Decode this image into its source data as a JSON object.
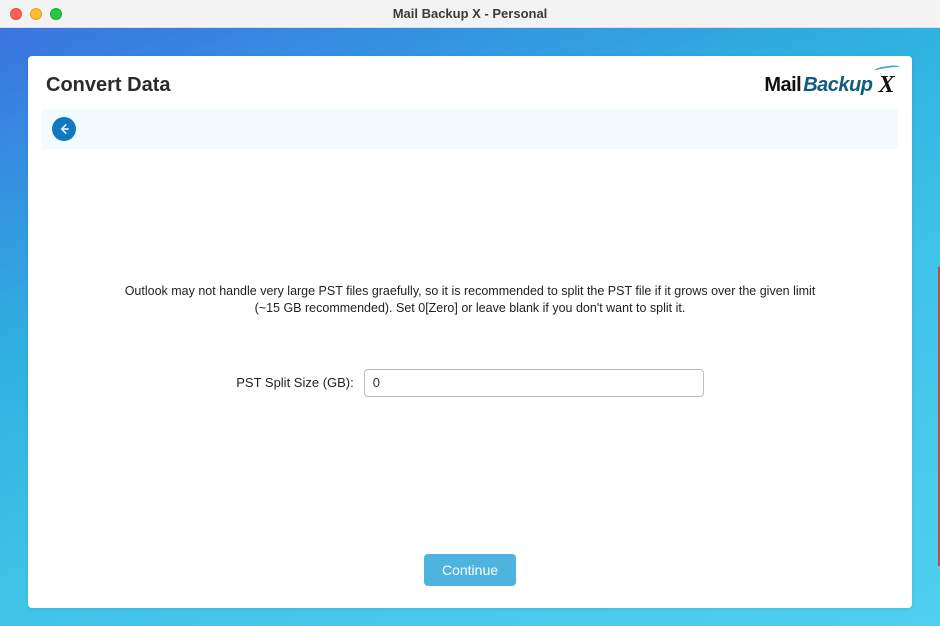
{
  "window": {
    "title": "Mail Backup X - Personal"
  },
  "page": {
    "title": "Convert Data"
  },
  "logo": {
    "part1": "Mail",
    "part2": "Backup",
    "x": "X"
  },
  "nav": {
    "back_label": "Back"
  },
  "desc": {
    "text": "Outlook may not handle very large PST files graefully, so it is recommended to split the PST file if it grows over the given limit (~15 GB recommended). Set 0[Zero] or leave blank if you don't want to split it."
  },
  "form": {
    "pst_split_label": "PST Split Size (GB):",
    "pst_split_value": "0"
  },
  "buttons": {
    "continue": "Continue"
  }
}
